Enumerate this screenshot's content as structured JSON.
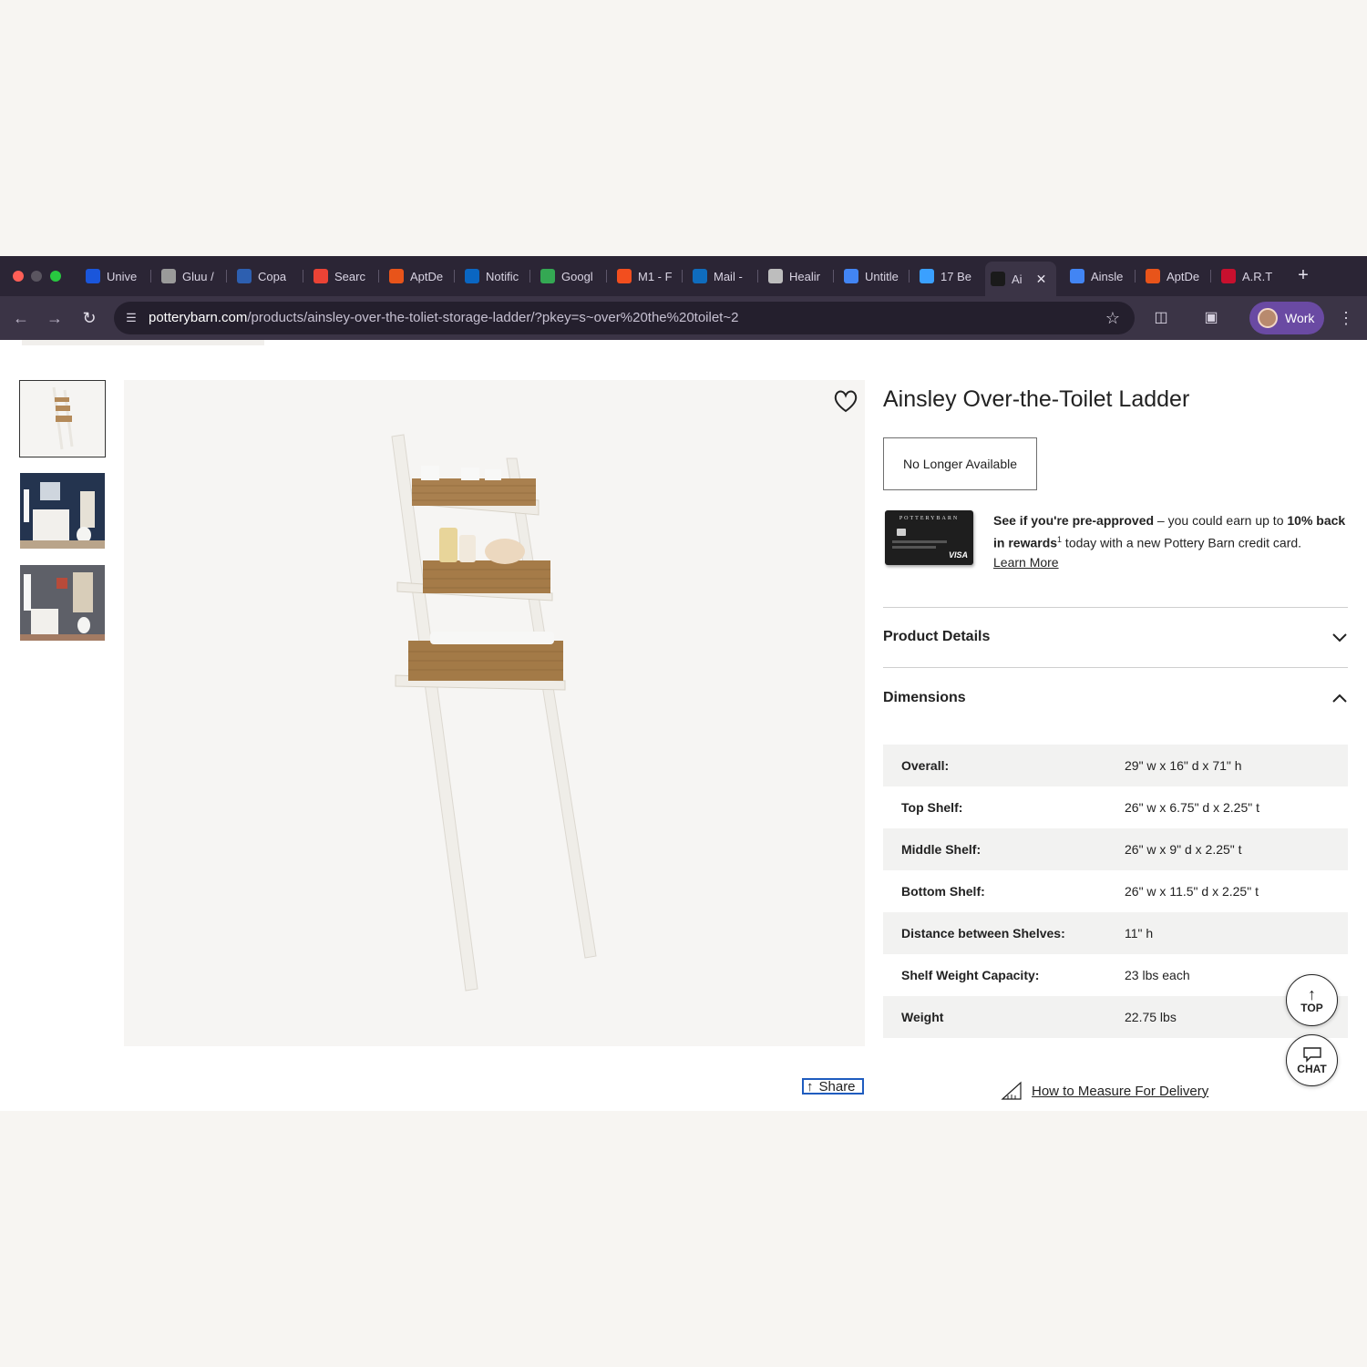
{
  "browser": {
    "tabs": [
      {
        "label": "Unive",
        "icon": "university-icon",
        "color": "#1a56db"
      },
      {
        "label": "Gluu /",
        "icon": "globe-icon",
        "color": "#9a9a9a"
      },
      {
        "label": "Copa",
        "icon": "flag-icon",
        "color": "#2d5fb0"
      },
      {
        "label": "Searc",
        "icon": "gmail-icon",
        "color": "#ea4335"
      },
      {
        "label": "AptDe",
        "icon": "aptdeco-icon",
        "color": "#e8541a"
      },
      {
        "label": "Notific",
        "icon": "linkedin-icon",
        "color": "#0a66c2"
      },
      {
        "label": "Googl",
        "icon": "google-meet-icon",
        "color": "#34a853"
      },
      {
        "label": "M1 - F",
        "icon": "figma-icon",
        "color": "#f24e1e"
      },
      {
        "label": "Mail -",
        "icon": "outlook-icon",
        "color": "#0f6cbd"
      },
      {
        "label": "Healir",
        "icon": "openai-icon",
        "color": "#bdbdbd"
      },
      {
        "label": "Untitle",
        "icon": "docs-icon",
        "color": "#4285f4"
      },
      {
        "label": "17 Be",
        "icon": "home-icon",
        "color": "#3aa0ff"
      },
      {
        "label": "Ai",
        "icon": "potterybarn-icon",
        "color": "#1a1a1a"
      },
      {
        "label": "Ainsle",
        "icon": "google-icon",
        "color": "#4285f4"
      },
      {
        "label": "AptDe",
        "icon": "aptdeco-icon",
        "color": "#e8541a"
      },
      {
        "label": "A.R.T",
        "icon": "h-icon",
        "color": "#c8102e"
      }
    ],
    "url_host": "potterybarn.com",
    "url_path": "/products/ainsley-over-the-toliet-storage-ladder/?pkey=s~over%20the%20toilet~2",
    "profile_label": "Work"
  },
  "product": {
    "title": "Ainsley Over-the-Toilet Ladder",
    "availability": "No Longer Available",
    "card_brand": "POTTERYBARN",
    "card_network": "VISA",
    "promo_bold1": "See if you're pre-approved",
    "promo_text1": " – you could earn up to ",
    "promo_bold2": "10% back in rewards",
    "promo_sup": "1",
    "promo_text2": " today with a new Pottery Barn credit card.",
    "promo_link": "Learn More",
    "share_label": "Share"
  },
  "accordion": {
    "details_label": "Product Details",
    "dimensions_label": "Dimensions"
  },
  "dimensions": [
    {
      "key": "Overall:",
      "value": "29\" w x 16\" d x 71\" h"
    },
    {
      "key": "Top Shelf:",
      "value": "26\" w x 6.75\" d x 2.25\" t"
    },
    {
      "key": "Middle Shelf:",
      "value": "26\" w x 9\" d x 2.25\" t"
    },
    {
      "key": "Bottom Shelf:",
      "value": "26\" w x 11.5\" d x 2.25\" t"
    },
    {
      "key": "Distance between Shelves:",
      "value": "11\" h"
    },
    {
      "key": "Shelf Weight Capacity:",
      "value": "23 lbs each"
    },
    {
      "key": "Weight",
      "value": "22.75 lbs"
    }
  ],
  "measure_link": "How to Measure For Delivery",
  "fab": {
    "top": "TOP",
    "chat": "CHAT"
  }
}
